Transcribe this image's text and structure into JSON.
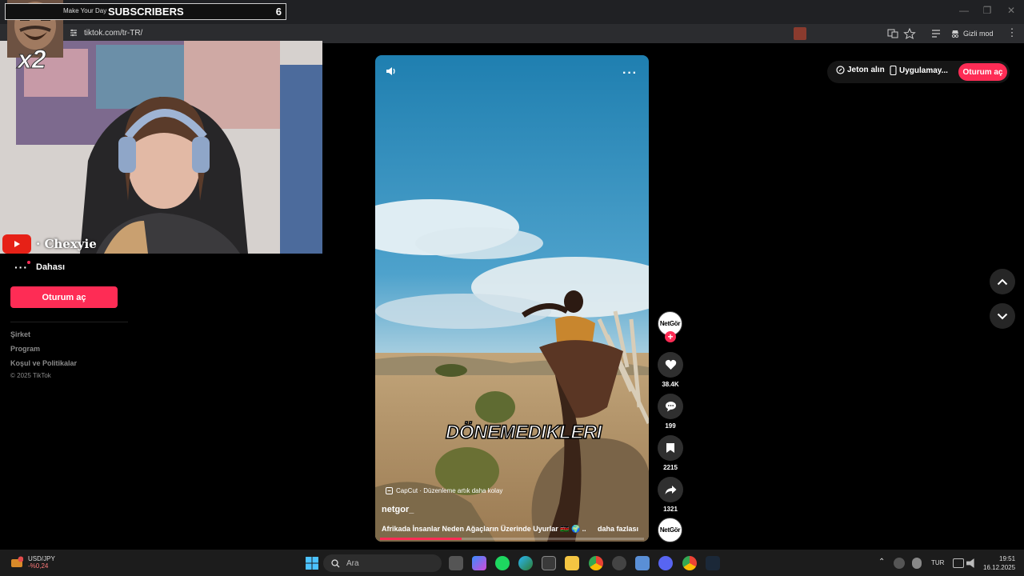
{
  "browser": {
    "url": "tiktok.com/tr-TR/",
    "incognito_label": "Gizli mod"
  },
  "stream_overlay": {
    "small_text": "Make Your Day",
    "subscribers_label": "SUBSCRIBERS",
    "subscribers_count": "6",
    "multiplier": "x2",
    "streamer_name": "· Chexyie"
  },
  "sidebar": {
    "more_label": "Dahası",
    "login_label": "Oturum aç",
    "footer_links": [
      "Şirket",
      "Program",
      "Koşul ve Politikalar"
    ],
    "copyright": "© 2025 TikTok"
  },
  "header": {
    "coins_label": "Jeton alın",
    "app_label": "Uygulamay...",
    "login_label": "Oturum aç"
  },
  "video": {
    "caption": "DÖNEMEDIKLERI",
    "capcut_label": "CapCut · Düzenleme artık daha kolay",
    "author": "netgor_",
    "description": "Afrikada İnsanlar Neden Ağaçların Üzerinde Uyurlar 🇰🇪 🌍 ...",
    "more_label": "daha fazlası",
    "progress": 0.31
  },
  "actions": {
    "avatar_label": "NetGör",
    "likes": "38.4K",
    "comments": "199",
    "saves": "2215",
    "shares": "1321",
    "music_label": "NetGör"
  },
  "taskbar": {
    "ticker_name": "USD/JPY",
    "ticker_change": "-%0,24",
    "search_placeholder": "Ara",
    "language": "TUR",
    "time": "19:51",
    "date": "16.12.2025"
  },
  "colors": {
    "accent": "#fe2c55",
    "sky": "#2f8fc0",
    "ground": "#b79a6d"
  }
}
